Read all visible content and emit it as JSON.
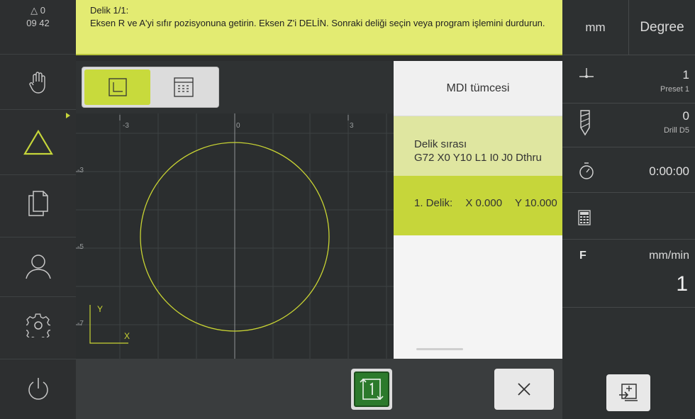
{
  "status": {
    "axis_label": "0",
    "time": "09 42"
  },
  "banner": {
    "title": "Delik 1/1:",
    "text": "Eksen R ve A'yi sıfır pozisyonuna getirin. Eksen Z'i DELİN. Sonraki deliği seçin veya program işlemini durdurun."
  },
  "sidebar": {
    "items": [
      {
        "name": "hand-icon"
      },
      {
        "name": "delta-icon",
        "active": true
      },
      {
        "name": "files-icon"
      },
      {
        "name": "user-icon"
      },
      {
        "name": "gear-icon"
      },
      {
        "name": "power-icon"
      }
    ]
  },
  "graphic": {
    "x_ticks": [
      "-3",
      "0",
      "3"
    ],
    "y_ticks": [
      "-3",
      "-5",
      "-7"
    ],
    "axis_y": "Y",
    "axis_x": "X"
  },
  "mdi": {
    "header": "MDI tümcesi",
    "seq_title": "Delik sırası",
    "seq_code": "G72 X0 Y10 L1 I0 J0 Dthru",
    "hole_label": "1. Delik:",
    "hole_x": "X 0.000",
    "hole_y": "Y 10.000"
  },
  "right": {
    "unit_length": "mm",
    "unit_angle": "Degree",
    "preset_value": "1",
    "preset_label": "Preset 1",
    "tool_value": "0",
    "tool_label": "Drill D5",
    "timer": "0:00:00",
    "feed_label": "F",
    "feed_unit": "mm/min",
    "feed_value": "1"
  },
  "colors": {
    "accent": "#c6d63a",
    "banner": "#e3eb72",
    "circle": "#c9d433",
    "cycle_button": "#2c7a2c"
  }
}
